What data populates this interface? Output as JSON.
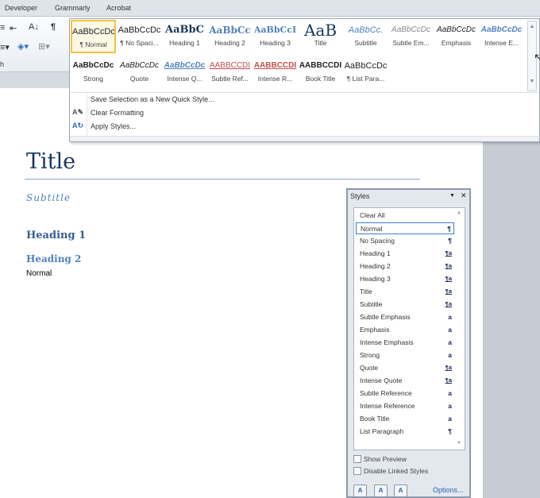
{
  "ribbon_tabs": [
    "Developer",
    "Grammarly",
    "Acrobat"
  ],
  "ribbon": {
    "group_label_fragment": "h"
  },
  "gallery": {
    "row1": [
      {
        "preview": "AaBbCcDc",
        "label": "¶ Normal",
        "selected": true
      },
      {
        "preview": "AaBbCcDc",
        "label": "¶ No Spaci..."
      },
      {
        "preview": "AaBbC",
        "label": "Heading 1"
      },
      {
        "preview": "AaBbCc",
        "label": "Heading 2"
      },
      {
        "preview": "AaBbCcI",
        "label": "Heading 3"
      },
      {
        "preview": "AaB",
        "label": "Title"
      },
      {
        "preview": "AaBbCc.",
        "label": "Subtitle"
      },
      {
        "preview": "AaBbCcDc",
        "label": "Subtle Em..."
      },
      {
        "preview": "AaBbCcDc",
        "label": "Emphasis"
      },
      {
        "preview": "AaBbCcDc",
        "label": "Intense E..."
      }
    ],
    "row2": [
      {
        "preview": "AaBbCcDc",
        "label": "Strong"
      },
      {
        "preview": "AaBbCcDc",
        "label": "Quote"
      },
      {
        "preview": "AaBbCcDc",
        "label": "Intense Q..."
      },
      {
        "preview": "AABBCCDI",
        "label": "Subtle Ref..."
      },
      {
        "preview": "AABBCCDI",
        "label": "Intense R..."
      },
      {
        "preview": "AABBCCDI",
        "label": "Book Title"
      },
      {
        "preview": "AaBbCcDc",
        "label": "¶ List Para..."
      }
    ],
    "menu": [
      "Save Selection as a New Quick Style...",
      "Clear Formatting",
      "Apply Styles..."
    ]
  },
  "document": {
    "title": "Title",
    "subtitle": "Subtitle",
    "heading1": "Heading 1",
    "heading2": "Heading 2",
    "normal": "Normal"
  },
  "styles_pane": {
    "title": "Styles",
    "items": [
      {
        "name": "Clear All",
        "sym": ""
      },
      {
        "name": "Normal",
        "sym": "¶",
        "selected": true
      },
      {
        "name": "No Spacing",
        "sym": "¶"
      },
      {
        "name": "Heading 1",
        "sym": "¶a"
      },
      {
        "name": "Heading 2",
        "sym": "¶a"
      },
      {
        "name": "Heading 3",
        "sym": "¶a"
      },
      {
        "name": "Title",
        "sym": "¶a"
      },
      {
        "name": "Subtitle",
        "sym": "¶a"
      },
      {
        "name": "Subtle Emphasis",
        "sym": "a"
      },
      {
        "name": "Emphasis",
        "sym": "a"
      },
      {
        "name": "Intense Emphasis",
        "sym": "a"
      },
      {
        "name": "Strong",
        "sym": "a"
      },
      {
        "name": "Quote",
        "sym": "¶a"
      },
      {
        "name": "Intense Quote",
        "sym": "¶a"
      },
      {
        "name": "Subtle Reference",
        "sym": "a"
      },
      {
        "name": "Intense Reference",
        "sym": "a"
      },
      {
        "name": "Book Title",
        "sym": "a"
      },
      {
        "name": "List Paragraph",
        "sym": "¶"
      }
    ],
    "show_preview": "Show Preview",
    "disable_linked": "Disable Linked Styles",
    "options": "Options..."
  }
}
